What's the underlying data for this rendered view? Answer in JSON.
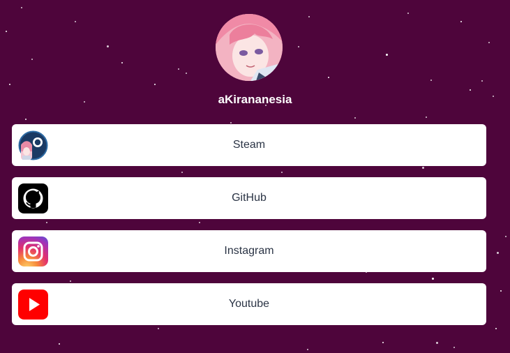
{
  "profile": {
    "username": "aKirananesia",
    "avatar_icon": "anime-avatar-icon"
  },
  "colors": {
    "background": "#4e053b",
    "card": "#ffffff",
    "label": "#2b3445",
    "github": "#000000",
    "youtube": "#ff0000"
  },
  "links": [
    {
      "label": "Steam",
      "icon": "steam-icon"
    },
    {
      "label": "GitHub",
      "icon": "github-icon"
    },
    {
      "label": "Instagram",
      "icon": "instagram-icon"
    },
    {
      "label": "Youtube",
      "icon": "youtube-icon"
    }
  ]
}
